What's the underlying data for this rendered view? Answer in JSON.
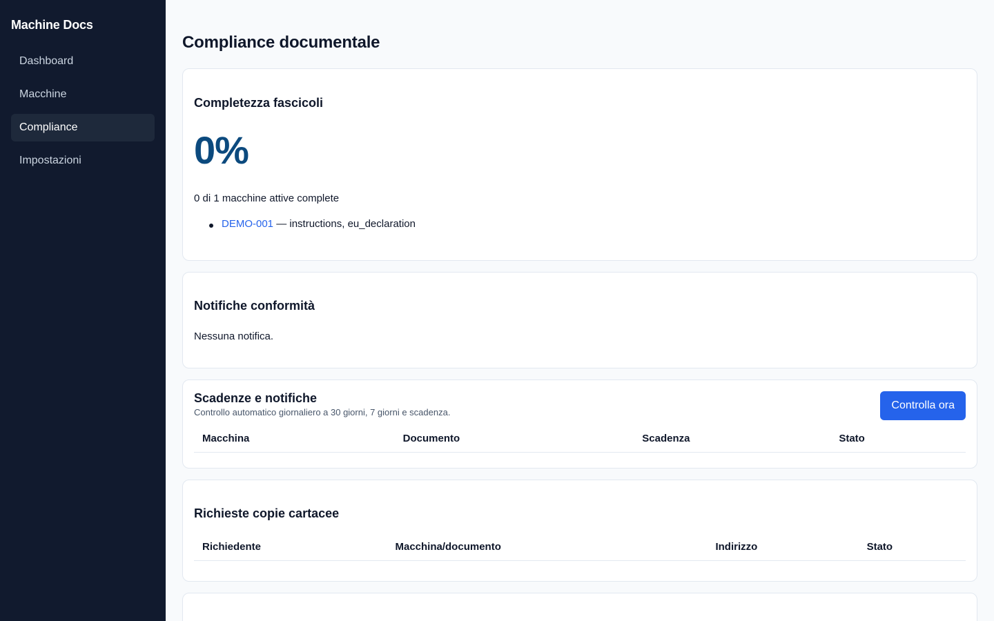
{
  "app": {
    "brand": "Machine Docs"
  },
  "sidebar": {
    "items": [
      {
        "label": "Dashboard"
      },
      {
        "label": "Macchine"
      },
      {
        "label": "Compliance"
      },
      {
        "label": "Impostazioni"
      }
    ],
    "active": "Compliance"
  },
  "page": {
    "title": "Compliance documentale"
  },
  "completeness": {
    "title": "Completezza fascicoli",
    "percent": "0%",
    "summary": "0 di 1 macchine attive complete",
    "missing": [
      {
        "machine": "DEMO-001",
        "docs": " — instructions, eu_declaration"
      }
    ]
  },
  "notifications": {
    "title": "Notifiche conformità",
    "empty": "Nessuna notifica."
  },
  "deadlines": {
    "title": "Scadenze e notifiche",
    "subtitle": "Controllo automatico giornaliero a 30 giorni, 7 giorni e scadenza.",
    "button": "Controlla ora",
    "columns": [
      "Macchina",
      "Documento",
      "Scadenza",
      "Stato"
    ]
  },
  "paper_requests": {
    "title": "Richieste copie cartacee",
    "columns": [
      "Richiedente",
      "Macchina/documento",
      "Indirizzo",
      "Stato"
    ]
  },
  "colors": {
    "sidebar_bg": "#111a2e",
    "accent": "#2563eb",
    "percent": "#0c4a7e",
    "page_bg": "#f8fafc"
  }
}
